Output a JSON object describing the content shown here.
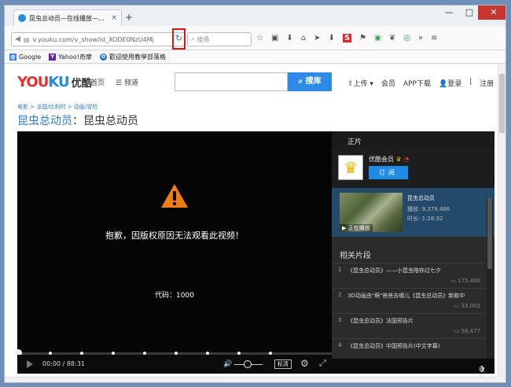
{
  "browser": {
    "tab_title": "昆虫总动员—在线播放—...",
    "tab_close": "×",
    "new_tab": "+",
    "win_min": "—",
    "win_max": "□",
    "win_close": "✕",
    "url": "v.youku.com/v_show/id_XODE0NzU4Mj",
    "search_placeholder": "搜尋",
    "bookmarks": [
      {
        "label": "Google",
        "icon": "google-icon"
      },
      {
        "label": "Yahoo!奇摩",
        "icon": "yahoo-icon"
      },
      {
        "label": "歡迎使用教學部落格",
        "icon": "blog-icon"
      }
    ]
  },
  "header": {
    "logo_latin_1": "YOU",
    "logo_latin_2": "KU",
    "logo_cn": "优酷",
    "nav_home": "首页",
    "nav_channels": "频道",
    "search_button": "搜库",
    "links": [
      "上传",
      "会员",
      "APP下载",
      "登录",
      "注册"
    ]
  },
  "breadcrumb": "电影 > 法国/比利时 > 动画/冒险",
  "page_title_main": "昆虫总动员",
  "page_title_sep": "：",
  "page_title_sub": "昆虫总动员",
  "player": {
    "error_message": "抱歉，因版权原因无法观看此视频！",
    "error_code": "代码：1000",
    "time": "00:00 / 88:31",
    "quality": "标清"
  },
  "side": {
    "tab": "正片",
    "vip_name": "优酷会员",
    "subscribe": "订阅",
    "current": {
      "title": "昆虫总动员",
      "plays": "播放: 9,379,486",
      "duration": "时长: 1:28:32",
      "playing": "正在播放"
    },
    "related_title": "相关片段",
    "episodes": [
      {
        "n": "1",
        "title": "《昆虫总动员》——小昆虫陪你过七夕",
        "views": "175,480"
      },
      {
        "n": "2",
        "title": "3D动画由\"萌\"爸爸去哪儿《昆虫总动员》新款中",
        "views": "33,002"
      },
      {
        "n": "3",
        "title": "《昆虫总动员》法国预告片",
        "views": "58,477"
      },
      {
        "n": "4",
        "title": "《昆虫总动员》中国预告片(中文字幕)",
        "views": ""
      }
    ],
    "collapse": "收起列表"
  }
}
